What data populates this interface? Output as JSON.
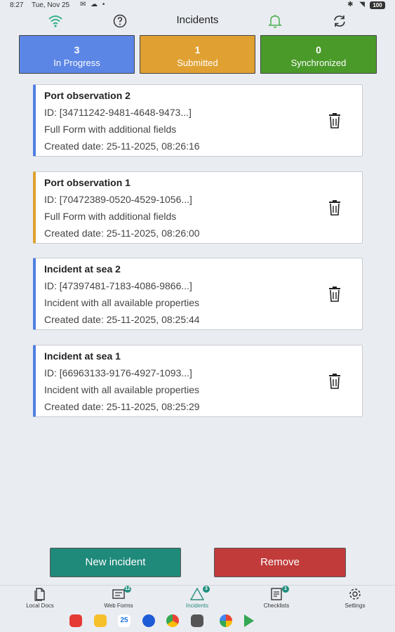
{
  "status_bar": {
    "time": "8:27",
    "date": "Tue, Nov 25",
    "battery": "100"
  },
  "header": {
    "title": "Incidents"
  },
  "counters": [
    {
      "count": "3",
      "label": "In Progress",
      "color": "#5b86e5"
    },
    {
      "count": "1",
      "label": "Submitted",
      "color": "#e0a132"
    },
    {
      "count": "0",
      "label": "Synchronized",
      "color": "#4a9a2a"
    }
  ],
  "cards": [
    {
      "title": "Port observation 2",
      "id": "ID: [34711242-9481-4648-9473...]",
      "description": "Full Form with additional fields",
      "created": "Created date: 25-11-2025, 08:26:16",
      "status_color": "#4f7fe0"
    },
    {
      "title": "Port observation 1",
      "id": "ID: [70472389-0520-4529-1056...]",
      "description": "Full Form with additional fields",
      "created": "Created date: 25-11-2025, 08:26:00",
      "status_color": "#e0a132"
    },
    {
      "title": "Incident at sea 2",
      "id": "ID: [47397481-7183-4086-9866...]",
      "description": "Incident with all available properties",
      "created": "Created date: 25-11-2025, 08:25:44",
      "status_color": "#4f7fe0"
    },
    {
      "title": "Incident at sea 1",
      "id": "ID: [66963133-9176-4927-1093...]",
      "description": "Incident with all available properties",
      "created": "Created date: 25-11-2025, 08:25:29",
      "status_color": "#4f7fe0"
    }
  ],
  "actions": {
    "new_label": "New incident",
    "remove_label": "Remove",
    "new_color": "#1f8a7a",
    "remove_color": "#c23b3b"
  },
  "bottom_nav": [
    {
      "label": "Local Docs",
      "icon": "document-icon",
      "badge": ""
    },
    {
      "label": "Web Forms",
      "icon": "form-icon",
      "badge": "12"
    },
    {
      "label": "Incidents",
      "icon": "warning-triangle-icon",
      "badge": "3"
    },
    {
      "label": "Checklists",
      "icon": "checklist-icon",
      "badge": "1"
    },
    {
      "label": "Settings",
      "icon": "gear-icon",
      "badge": ""
    }
  ],
  "dock": {
    "calendar_day": "25"
  }
}
